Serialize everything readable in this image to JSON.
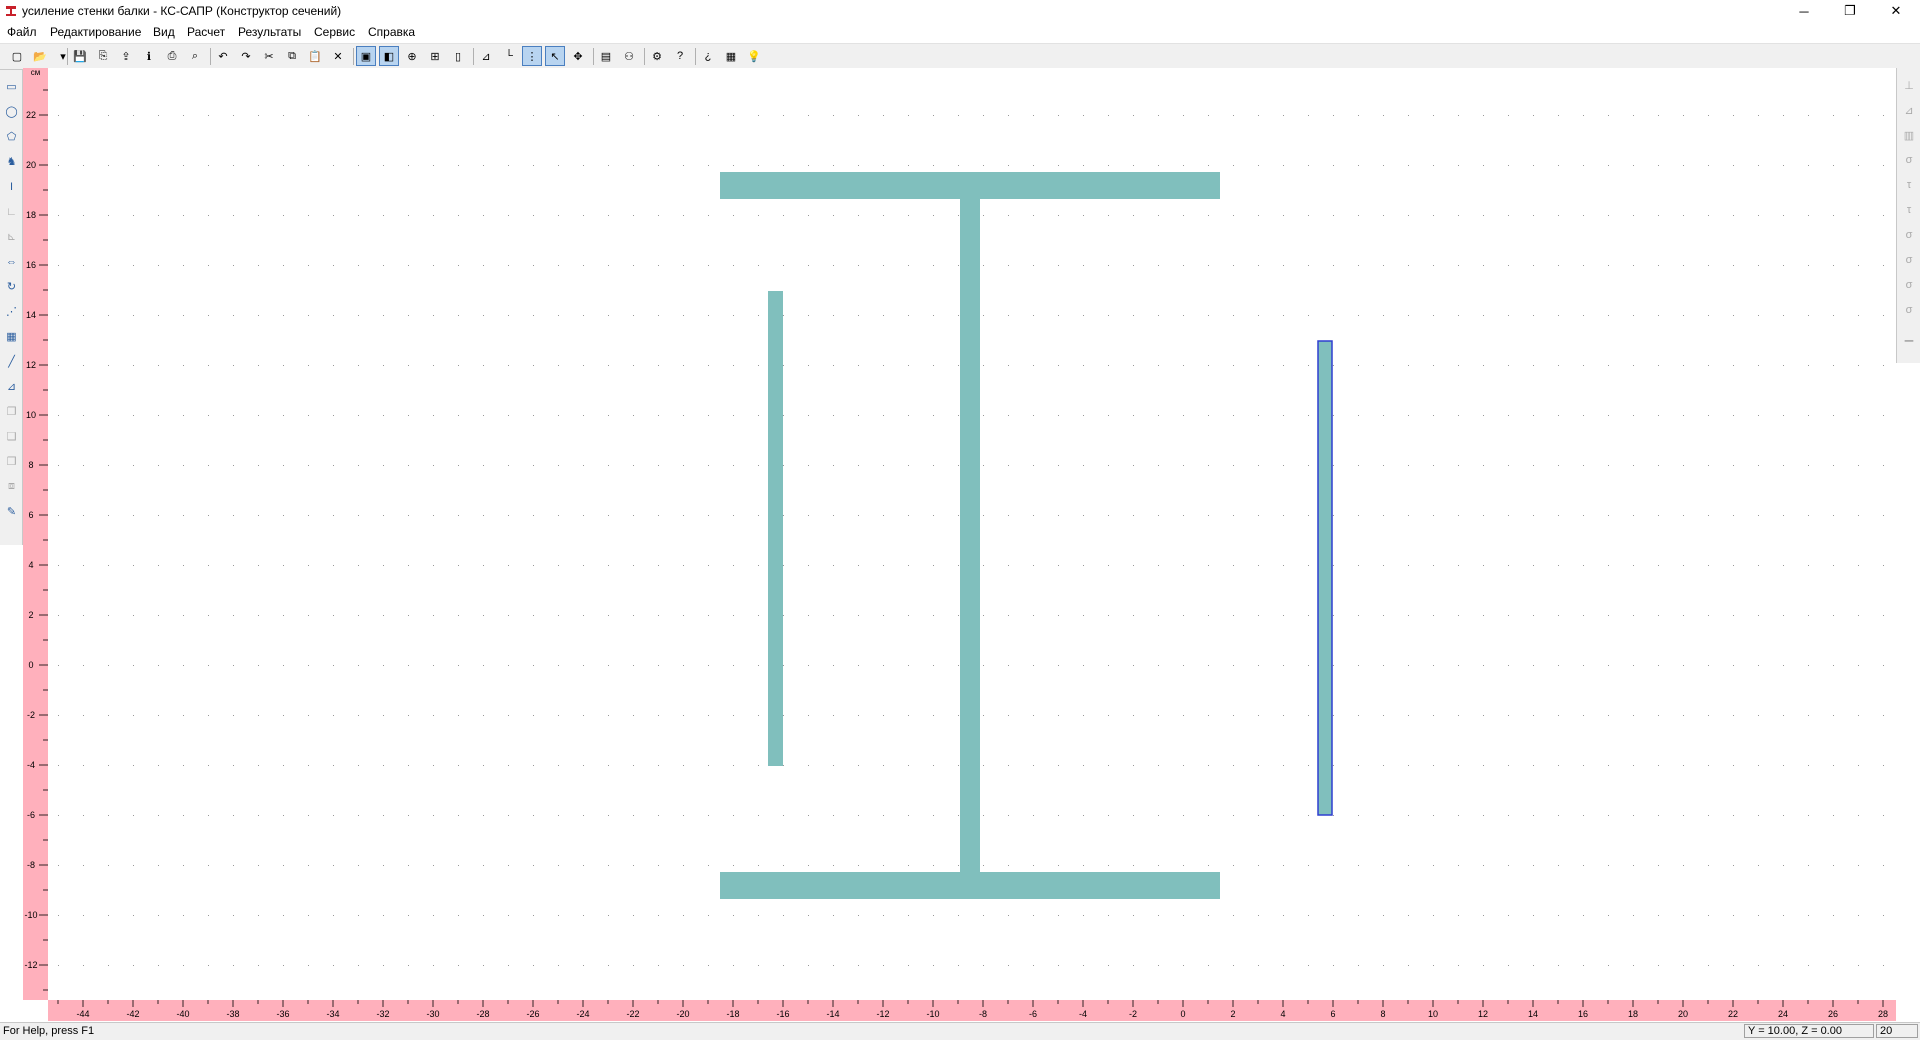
{
  "window": {
    "title": "усиление стенки балки - КС-САПР (Конструктор сечений)",
    "minimize": "─",
    "restore": "❐",
    "close": "✕"
  },
  "menu": [
    "Файл",
    "Редактирование",
    "Вид",
    "Расчет",
    "Результаты",
    "Сервис",
    "Справка"
  ],
  "toolbar": {
    "buttons": [
      "new-icon",
      "open-icon",
      "dropdown-icon",
      "save-icon",
      "save-as-icon",
      "export-icon",
      "info-icon",
      "print-icon",
      "print-preview-icon",
      "undo-icon",
      "redo-icon",
      "cut-icon",
      "copy-icon",
      "paste-icon",
      "delete-icon",
      "select-mode-icon",
      "fill-mode-icon",
      "zoom-icon",
      "zoom-window-icon",
      "page-icon",
      "dimension-icon",
      "axes-icon",
      "grid-icon",
      "snap-icon",
      "move-icon",
      "layers-icon",
      "binoculars-icon",
      "calc-icon",
      "help-icon",
      "whats-this-icon",
      "about-icon",
      "tip-icon"
    ],
    "active": [
      "select-mode-icon",
      "fill-mode-icon",
      "grid-icon",
      "snap-icon"
    ]
  },
  "left_tools": [
    "rectangle-icon",
    "ellipse-icon",
    "polygon-icon",
    "profile-icon",
    "i-beam-icon",
    "angle-icon",
    "angle-dim-icon",
    "mirror-icon",
    "rotate-icon",
    "nodes-icon",
    "array-icon",
    "line-icon",
    "dimension-icon",
    "copy-layer-icon",
    "layer-2-icon",
    "layer-3-icon",
    "layer-4-icon",
    "properties-icon"
  ],
  "right_tools": [
    "result-1-icon",
    "result-2-icon",
    "result-3-icon",
    "sigma-x-icon",
    "tau-zy-icon",
    "tau-xz-icon",
    "sigma-1-icon",
    "sigma-2-icon",
    "sigma-e-icon",
    "sigma-n-icon",
    "diagram-icon"
  ],
  "ruler": {
    "unit": "см",
    "x_ticks": [
      "-44",
      "-42",
      "-40",
      "-38",
      "-36",
      "-34",
      "-32",
      "-30",
      "-28",
      "-26",
      "-24",
      "-22",
      "-20",
      "-18",
      "-16",
      "-14",
      "-12",
      "-10",
      "-8",
      "-6",
      "-4",
      "-2",
      "0",
      "2",
      "4",
      "6",
      "8",
      "10",
      "12",
      "14",
      "16",
      "18",
      "20",
      "22",
      "24",
      "26",
      "28"
    ],
    "y_ticks": [
      "22",
      "20",
      "18",
      "16",
      "14",
      "12",
      "10",
      "8",
      "6",
      "4",
      "2",
      "0",
      "-2",
      "-4",
      "-6",
      "-8",
      "-10",
      "-12"
    ]
  },
  "drawing": {
    "fill": "#80bfbd",
    "selected_stroke": "#2f3fd0",
    "grid_dot": "#999999"
  },
  "status": {
    "help": "For Help, press F1",
    "coords": "Y = 10.00, Z = 0.00",
    "scale": "20"
  },
  "colors": {
    "ruler": "#ffb0bc",
    "toolbar": "#f0f0f0"
  }
}
